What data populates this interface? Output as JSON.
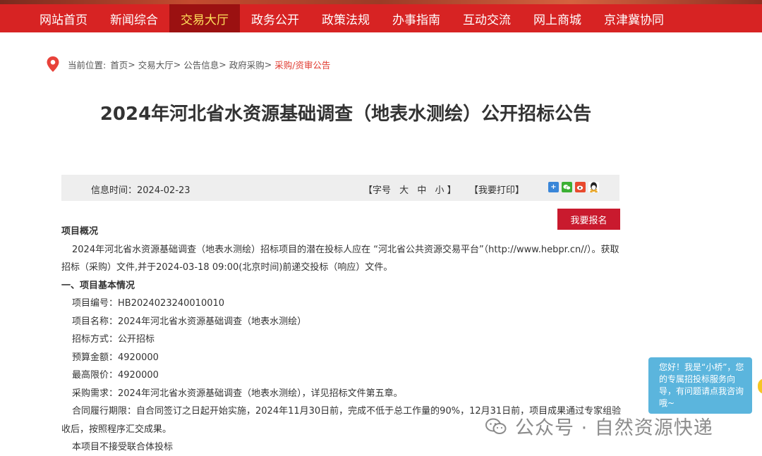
{
  "nav": {
    "items": [
      {
        "label": "网站首页"
      },
      {
        "label": "新闻综合"
      },
      {
        "label": "交易大厅"
      },
      {
        "label": "政务公开"
      },
      {
        "label": "政策法规"
      },
      {
        "label": "办事指南"
      },
      {
        "label": "互动交流"
      },
      {
        "label": "网上商城"
      },
      {
        "label": "京津冀协同"
      }
    ],
    "active": "交易大厅"
  },
  "breadcrumb": {
    "prefix": "当前位置:",
    "items": [
      "首页",
      "交易大厅",
      "公告信息",
      "政府采购"
    ],
    "sep": ">",
    "current": "采购/资审公告"
  },
  "article": {
    "title": "2024年河北省水资源基础调查（地表水测绘）公开招标公告",
    "info_time_label": "信息时间：2024-02-23",
    "font_size_label": "【字号",
    "font_large": "大",
    "font_medium": "中",
    "font_small": "小 】",
    "print_label": "【我要打印】",
    "signup_label": "我要报名",
    "overview_heading": "项目概况",
    "overview_text": "2024年河北省水资源基础调查（地表水测绘）招标项目的潜在投标人应在 “河北省公共资源交易平台”（http://www.hebpr.cn//）。获取招标（采购）文件,并于2024-03-18 09:00(北京时间)前递交投标（响应）文件。",
    "section1_heading": "一、项目基本情况",
    "fields": [
      "项目编号：HB2024023240010010",
      "项目名称：2024年河北省水资源基础调查（地表水测绘）",
      "招标方式：公开招标",
      "预算金额：4920000",
      "最高限价：4920000",
      "采购需求：2024年河北省水资源基础调查（地表水测绘），详见招标文件第五章。"
    ],
    "contract_period": "合同履行期限：自合同签订之日起开始实施，2024年11月30日前，完成不低于总工作量的90%，12月31日前，项目成果通过专家组验收后，按照程序汇交成果。",
    "consortium_note": "本项目不接受联合体投标"
  },
  "chat": {
    "text": "您好！我是“小桥”，您的专属招投标服务向导，有问题请点我咨询哦~"
  },
  "watermark": {
    "text": "公众号 · 自然资源快递"
  },
  "share": {
    "icons": [
      "plus-share-icon",
      "wechat-icon",
      "weibo-icon",
      "qq-icon"
    ]
  },
  "colors": {
    "nav_bg": "#d72323",
    "nav_active_bg": "#9b1111",
    "nav_active_text": "#ffe05a",
    "signup_bg": "#c91a2e",
    "breadcrumb_current": "#e03a2f",
    "chat_bg": "#5bb5dd"
  }
}
